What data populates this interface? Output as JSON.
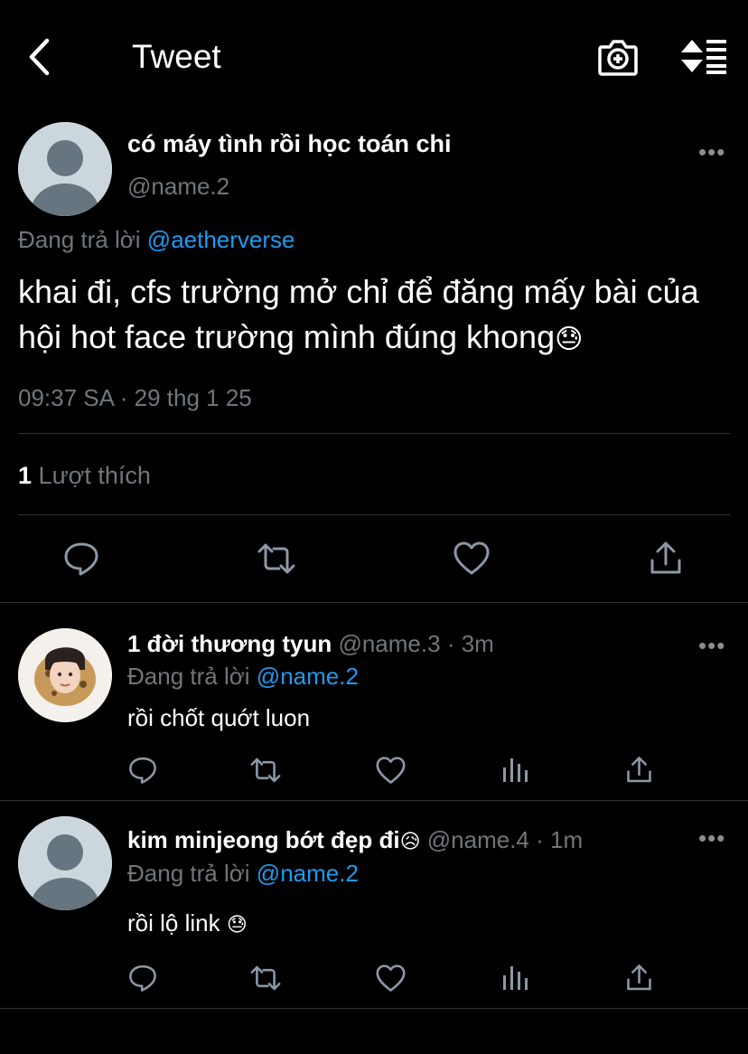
{
  "header": {
    "title": "Tweet",
    "back_icon": "chevron-left-icon",
    "camera_icon": "camera-plus-icon",
    "sort_icon": "sort-list-icon"
  },
  "main_tweet": {
    "display_name": "có máy tình rồi học toán chi",
    "handle": "@name.2",
    "reply_prefix": "Đang trả lời",
    "reply_to": "@aetherverse",
    "text_line1": "khai đi, cfs trường mở chỉ để đăng mấy bài của",
    "text_line2": "hội hot face trường mình đúng khong",
    "emoji": "😓",
    "timestamp": "09:37 SA · 29 thg 1 25",
    "likes_count": "1",
    "likes_label": "Lượt thích"
  },
  "replies": [
    {
      "display_name": "1 đời thương tyun",
      "handle": "@name.3",
      "time": "· 3m",
      "reply_prefix": "Đang trả lời",
      "reply_to": "@name.2",
      "text": "rồi chốt quớt luon"
    },
    {
      "display_name": "kim minjeong bớt đẹp đi",
      "name_emoji": "😥",
      "handle": "@name.4",
      "time": "· 1m",
      "reply_prefix": "Đang trả lời",
      "reply_to": "@name.2",
      "text": "rồi lộ link",
      "text_emoji": "😓"
    }
  ],
  "more_label": "•••",
  "colors": {
    "background": "#000000",
    "text": "#e7e9ea",
    "muted": "#71767b",
    "link": "#1d9bf0",
    "divider": "#2f3336"
  }
}
